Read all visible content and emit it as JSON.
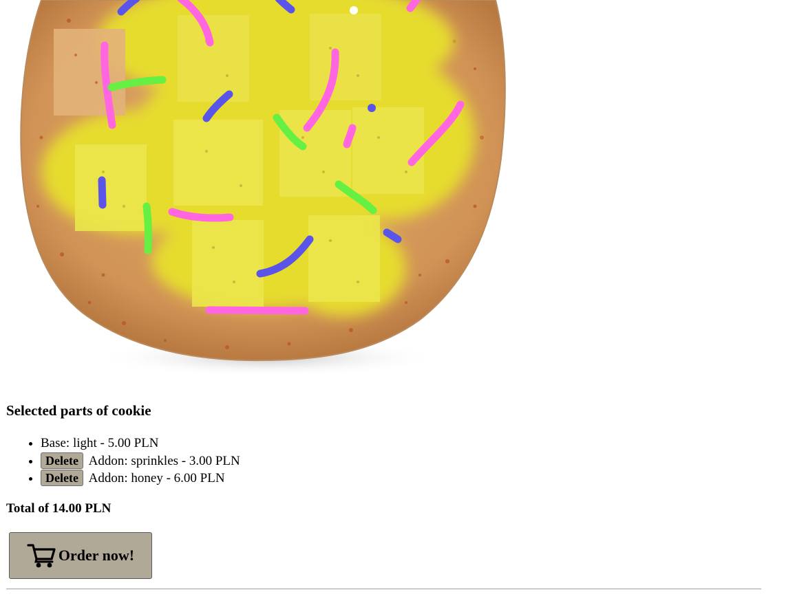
{
  "cookie_image": {
    "alt": "cookie preview",
    "colors": {
      "base": "#d39a5d",
      "base_edge": "#b87a45",
      "honey": "#e6dc2e",
      "sprinkle_pink": "#ff66e0",
      "sprinkle_green": "#66f044",
      "sprinkle_blue": "#5a55e8"
    }
  },
  "summary": {
    "heading": "Selected parts of cookie",
    "items": [
      {
        "text": "Base: light - 5.00 PLN",
        "deletable": false
      },
      {
        "delete_label": "Delete",
        "text": "Addon: sprinkles - 3.00 PLN",
        "deletable": true
      },
      {
        "delete_label": "Delete",
        "text": "Addon: honey - 6.00 PLN",
        "deletable": true
      }
    ],
    "total": "Total of 14.00 PLN"
  },
  "order_button": {
    "label": "Order now!",
    "icon": "cart-icon"
  }
}
